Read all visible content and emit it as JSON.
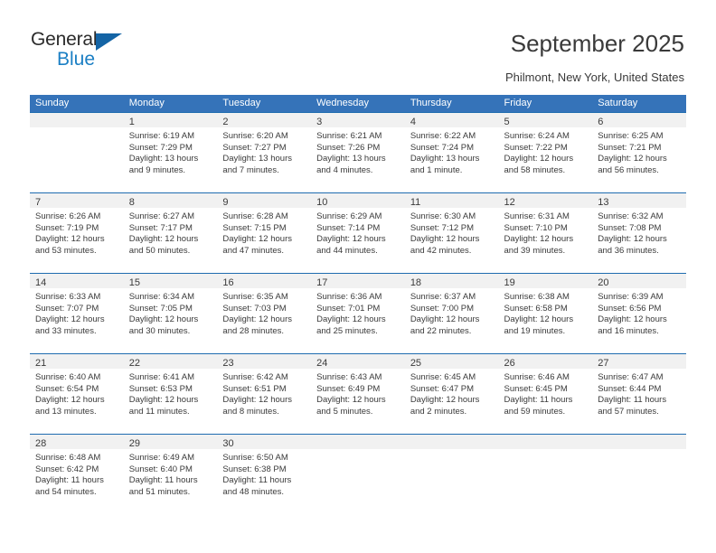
{
  "brand": {
    "name_part1": "General",
    "name_part2": "Blue",
    "accent_color": "#1b7fc4",
    "triangle_color": "#1464a5"
  },
  "header": {
    "title": "September 2025",
    "location": "Philmont, New York, United States"
  },
  "calendar": {
    "header_bg": "#3573b9",
    "row_divider_color": "#1f6cb0",
    "day_band_bg": "#f1f1f1",
    "weekdays": [
      "Sunday",
      "Monday",
      "Tuesday",
      "Wednesday",
      "Thursday",
      "Friday",
      "Saturday"
    ],
    "weeks": [
      [
        {
          "day": "",
          "empty": true
        },
        {
          "day": "1",
          "sunrise": "Sunrise: 6:19 AM",
          "sunset": "Sunset: 7:29 PM",
          "daylight1": "Daylight: 13 hours",
          "daylight2": "and 9 minutes."
        },
        {
          "day": "2",
          "sunrise": "Sunrise: 6:20 AM",
          "sunset": "Sunset: 7:27 PM",
          "daylight1": "Daylight: 13 hours",
          "daylight2": "and 7 minutes."
        },
        {
          "day": "3",
          "sunrise": "Sunrise: 6:21 AM",
          "sunset": "Sunset: 7:26 PM",
          "daylight1": "Daylight: 13 hours",
          "daylight2": "and 4 minutes."
        },
        {
          "day": "4",
          "sunrise": "Sunrise: 6:22 AM",
          "sunset": "Sunset: 7:24 PM",
          "daylight1": "Daylight: 13 hours",
          "daylight2": "and 1 minute."
        },
        {
          "day": "5",
          "sunrise": "Sunrise: 6:24 AM",
          "sunset": "Sunset: 7:22 PM",
          "daylight1": "Daylight: 12 hours",
          "daylight2": "and 58 minutes."
        },
        {
          "day": "6",
          "sunrise": "Sunrise: 6:25 AM",
          "sunset": "Sunset: 7:21 PM",
          "daylight1": "Daylight: 12 hours",
          "daylight2": "and 56 minutes."
        }
      ],
      [
        {
          "day": "7",
          "sunrise": "Sunrise: 6:26 AM",
          "sunset": "Sunset: 7:19 PM",
          "daylight1": "Daylight: 12 hours",
          "daylight2": "and 53 minutes."
        },
        {
          "day": "8",
          "sunrise": "Sunrise: 6:27 AM",
          "sunset": "Sunset: 7:17 PM",
          "daylight1": "Daylight: 12 hours",
          "daylight2": "and 50 minutes."
        },
        {
          "day": "9",
          "sunrise": "Sunrise: 6:28 AM",
          "sunset": "Sunset: 7:15 PM",
          "daylight1": "Daylight: 12 hours",
          "daylight2": "and 47 minutes."
        },
        {
          "day": "10",
          "sunrise": "Sunrise: 6:29 AM",
          "sunset": "Sunset: 7:14 PM",
          "daylight1": "Daylight: 12 hours",
          "daylight2": "and 44 minutes."
        },
        {
          "day": "11",
          "sunrise": "Sunrise: 6:30 AM",
          "sunset": "Sunset: 7:12 PM",
          "daylight1": "Daylight: 12 hours",
          "daylight2": "and 42 minutes."
        },
        {
          "day": "12",
          "sunrise": "Sunrise: 6:31 AM",
          "sunset": "Sunset: 7:10 PM",
          "daylight1": "Daylight: 12 hours",
          "daylight2": "and 39 minutes."
        },
        {
          "day": "13",
          "sunrise": "Sunrise: 6:32 AM",
          "sunset": "Sunset: 7:08 PM",
          "daylight1": "Daylight: 12 hours",
          "daylight2": "and 36 minutes."
        }
      ],
      [
        {
          "day": "14",
          "sunrise": "Sunrise: 6:33 AM",
          "sunset": "Sunset: 7:07 PM",
          "daylight1": "Daylight: 12 hours",
          "daylight2": "and 33 minutes."
        },
        {
          "day": "15",
          "sunrise": "Sunrise: 6:34 AM",
          "sunset": "Sunset: 7:05 PM",
          "daylight1": "Daylight: 12 hours",
          "daylight2": "and 30 minutes."
        },
        {
          "day": "16",
          "sunrise": "Sunrise: 6:35 AM",
          "sunset": "Sunset: 7:03 PM",
          "daylight1": "Daylight: 12 hours",
          "daylight2": "and 28 minutes."
        },
        {
          "day": "17",
          "sunrise": "Sunrise: 6:36 AM",
          "sunset": "Sunset: 7:01 PM",
          "daylight1": "Daylight: 12 hours",
          "daylight2": "and 25 minutes."
        },
        {
          "day": "18",
          "sunrise": "Sunrise: 6:37 AM",
          "sunset": "Sunset: 7:00 PM",
          "daylight1": "Daylight: 12 hours",
          "daylight2": "and 22 minutes."
        },
        {
          "day": "19",
          "sunrise": "Sunrise: 6:38 AM",
          "sunset": "Sunset: 6:58 PM",
          "daylight1": "Daylight: 12 hours",
          "daylight2": "and 19 minutes."
        },
        {
          "day": "20",
          "sunrise": "Sunrise: 6:39 AM",
          "sunset": "Sunset: 6:56 PM",
          "daylight1": "Daylight: 12 hours",
          "daylight2": "and 16 minutes."
        }
      ],
      [
        {
          "day": "21",
          "sunrise": "Sunrise: 6:40 AM",
          "sunset": "Sunset: 6:54 PM",
          "daylight1": "Daylight: 12 hours",
          "daylight2": "and 13 minutes."
        },
        {
          "day": "22",
          "sunrise": "Sunrise: 6:41 AM",
          "sunset": "Sunset: 6:53 PM",
          "daylight1": "Daylight: 12 hours",
          "daylight2": "and 11 minutes."
        },
        {
          "day": "23",
          "sunrise": "Sunrise: 6:42 AM",
          "sunset": "Sunset: 6:51 PM",
          "daylight1": "Daylight: 12 hours",
          "daylight2": "and 8 minutes."
        },
        {
          "day": "24",
          "sunrise": "Sunrise: 6:43 AM",
          "sunset": "Sunset: 6:49 PM",
          "daylight1": "Daylight: 12 hours",
          "daylight2": "and 5 minutes."
        },
        {
          "day": "25",
          "sunrise": "Sunrise: 6:45 AM",
          "sunset": "Sunset: 6:47 PM",
          "daylight1": "Daylight: 12 hours",
          "daylight2": "and 2 minutes."
        },
        {
          "day": "26",
          "sunrise": "Sunrise: 6:46 AM",
          "sunset": "Sunset: 6:45 PM",
          "daylight1": "Daylight: 11 hours",
          "daylight2": "and 59 minutes."
        },
        {
          "day": "27",
          "sunrise": "Sunrise: 6:47 AM",
          "sunset": "Sunset: 6:44 PM",
          "daylight1": "Daylight: 11 hours",
          "daylight2": "and 57 minutes."
        }
      ],
      [
        {
          "day": "28",
          "sunrise": "Sunrise: 6:48 AM",
          "sunset": "Sunset: 6:42 PM",
          "daylight1": "Daylight: 11 hours",
          "daylight2": "and 54 minutes."
        },
        {
          "day": "29",
          "sunrise": "Sunrise: 6:49 AM",
          "sunset": "Sunset: 6:40 PM",
          "daylight1": "Daylight: 11 hours",
          "daylight2": "and 51 minutes."
        },
        {
          "day": "30",
          "sunrise": "Sunrise: 6:50 AM",
          "sunset": "Sunset: 6:38 PM",
          "daylight1": "Daylight: 11 hours",
          "daylight2": "and 48 minutes."
        },
        {
          "day": "",
          "empty": true
        },
        {
          "day": "",
          "empty": true
        },
        {
          "day": "",
          "empty": true
        },
        {
          "day": "",
          "empty": true
        }
      ]
    ]
  }
}
